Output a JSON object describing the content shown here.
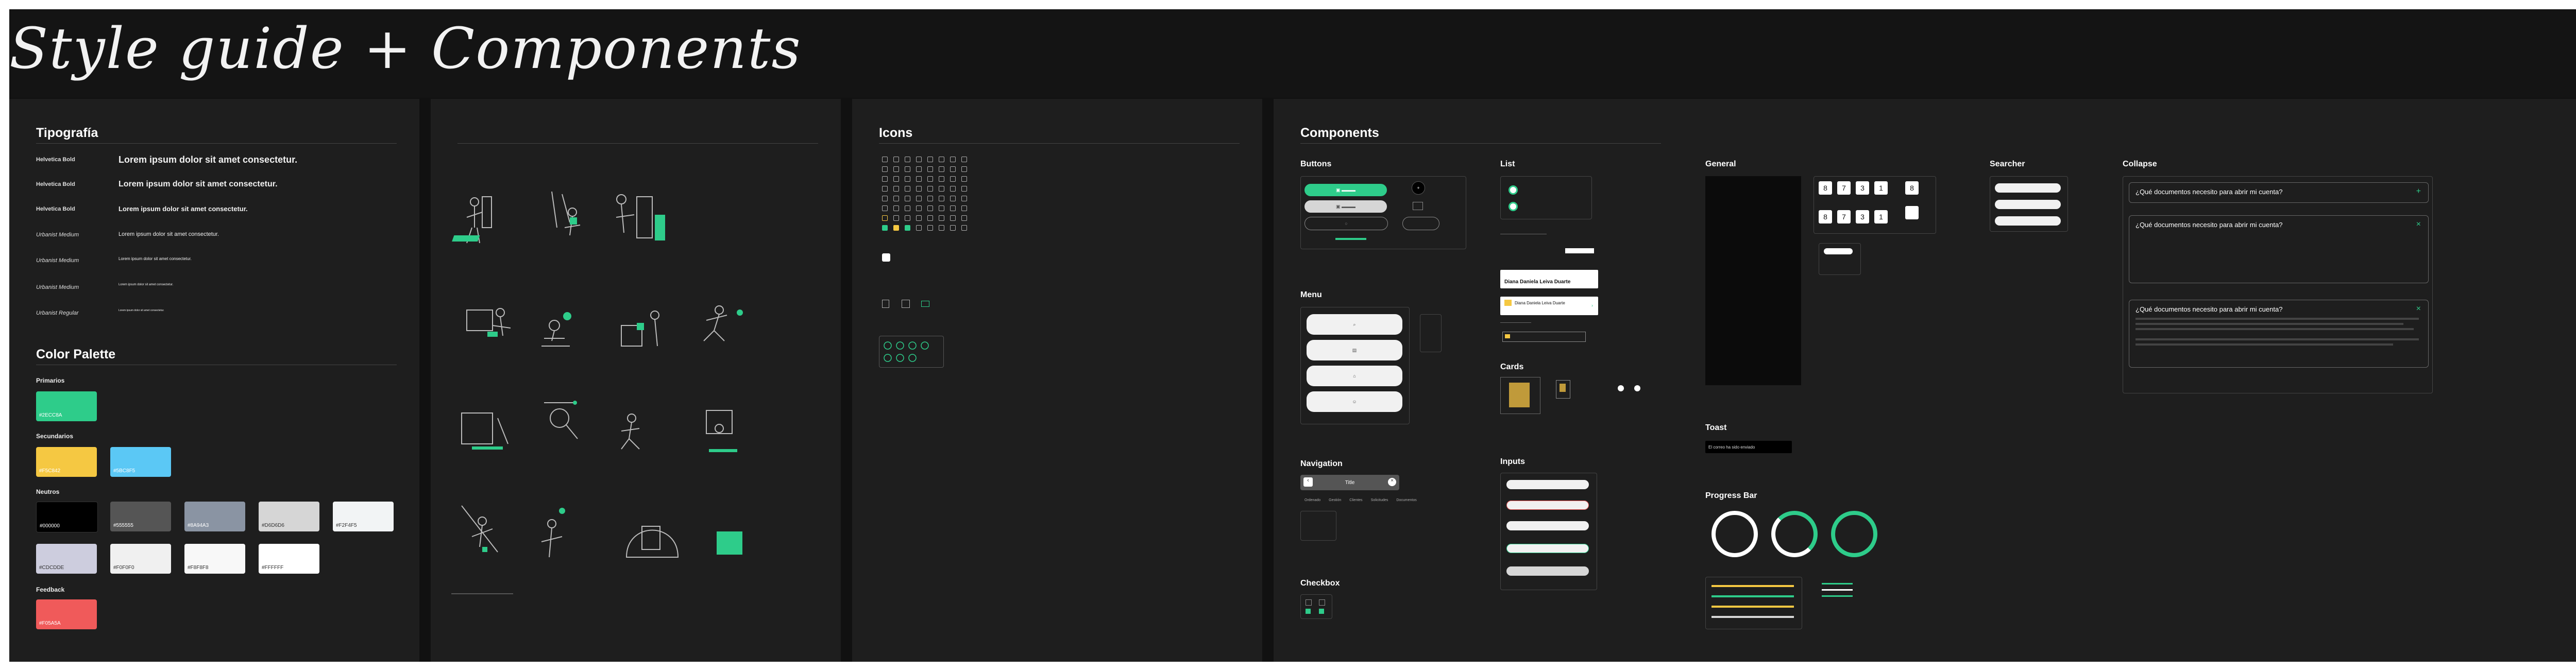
{
  "page": {
    "title": "Style guide + Components"
  },
  "colors": {
    "primary": "#2ecc8a",
    "yellow": "#f5c842",
    "blue": "#5bc8f5",
    "red": "#f05a5a"
  },
  "typography": {
    "title": "Tipografía",
    "rows": [
      {
        "label": "Helvetica Bold",
        "sample": "Lorem ipsum dolor sit amet consectetur."
      },
      {
        "label": "Helvetica Bold",
        "sample": "Lorem ipsum dolor sit amet consectetur."
      },
      {
        "label": "Helvetica Bold",
        "sample": "Lorem ipsum dolor sit amet consectetur."
      },
      {
        "label": "Urbanist Medium",
        "sample": "Lorem ipsum dolor sit amet consectetur."
      },
      {
        "label": "Urbanist Medium",
        "sample": "Lorem ipsum dolor sit amet consectetur."
      },
      {
        "label": "Urbanist Medium",
        "sample": "Lorem ipsum dolor sit amet consectetur."
      },
      {
        "label": "Urbanist Regular",
        "sample": "Lorem ipsum dolor sit amet consectetur."
      }
    ]
  },
  "palette": {
    "title": "Color Palette",
    "primarios": {
      "label": "Primarios",
      "swatches": [
        {
          "hex": "#2ECC8A"
        }
      ]
    },
    "secundarios": {
      "label": "Secundarios",
      "swatches": [
        {
          "hex": "#F5C842"
        },
        {
          "hex": "#5BC8F5"
        }
      ]
    },
    "neutros": {
      "label": "Neutros",
      "swatches": [
        {
          "hex": "#000000"
        },
        {
          "hex": "#555555"
        },
        {
          "hex": "#8A94A3"
        },
        {
          "hex": "#D6D6D6"
        },
        {
          "hex": "#F2F4F5"
        },
        {
          "hex": "#CDCDDE"
        },
        {
          "hex": "#F0F0F0"
        },
        {
          "hex": "#F8F8F8"
        },
        {
          "hex": "#FFFFFF"
        }
      ]
    },
    "feedback": {
      "label": "Feedback",
      "swatches": [
        {
          "hex": "#F05A5A"
        }
      ]
    }
  },
  "icons": {
    "title": "Icons"
  },
  "components": {
    "title": "Components",
    "buttons": {
      "title": "Buttons"
    },
    "menu": {
      "title": "Menu"
    },
    "navigation": {
      "title": "Navigation",
      "tab_label": "Title",
      "tabs": [
        "Ordenado",
        "Gestión",
        "Clientes",
        "Solicitudes",
        "Documentos"
      ]
    },
    "checkbox": {
      "title": "Checkbox"
    },
    "list": {
      "title": "List"
    },
    "list_card_1": "Diana Daniela Leiva Duarte",
    "list_card_2": "Diana Daniela Leiva Duarte",
    "cards": {
      "title": "Cards"
    },
    "inputs": {
      "title": "Inputs"
    },
    "general": {
      "title": "General"
    },
    "numpad_row1": [
      "8",
      "7",
      "3",
      "1"
    ],
    "numpad_row2": [
      "8",
      "7",
      "3",
      "1"
    ],
    "numpad_side": "8",
    "toast": {
      "title": "Toast",
      "text": "El correo ha sido enviado"
    },
    "progress": {
      "title": "Progress Bar"
    },
    "searcher": {
      "title": "Searcher"
    },
    "collapse": {
      "title": "Collapse",
      "question": "¿Qué documentos necesito para abrir mi cuenta?",
      "question2": "¿Qué documentos necesito para abrir mi cuenta?",
      "question3": "¿Qué documentos necesito para abrir mi cuenta?"
    }
  }
}
